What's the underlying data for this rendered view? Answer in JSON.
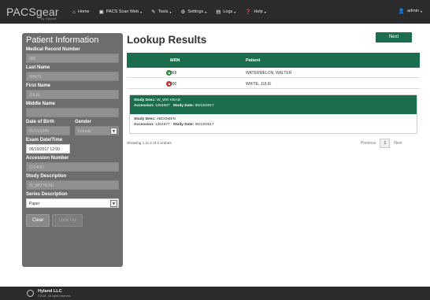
{
  "brand": {
    "name": "PACSgear",
    "sub": "by Hyland"
  },
  "nav": [
    {
      "icon": "⌂",
      "label": "Home",
      "caret": ""
    },
    {
      "icon": "▣",
      "label": "PACS Scan Web",
      "caret": "▾"
    },
    {
      "icon": "✎",
      "label": "Tools",
      "caret": "▾"
    },
    {
      "icon": "⚙",
      "label": "Settings",
      "caret": "▾"
    },
    {
      "icon": "▤",
      "label": "Logs",
      "caret": "▾"
    },
    {
      "icon": "❓",
      "label": "Help",
      "caret": "▾"
    }
  ],
  "user": {
    "icon": "👤",
    "label": "admin",
    "caret": "▾"
  },
  "form": {
    "title": "Patient Information",
    "mrn_label": "Medical Record Number",
    "mrn_value": "990",
    "last_label": "Last Name",
    "last_value": "WHITE",
    "first_label": "First Name",
    "first_value": "JULIE",
    "middle_label": "Middle Name",
    "middle_value": "",
    "dob_label": "Date of Birth",
    "dob_value": "01/01/1945",
    "gender_label": "Gender",
    "gender_value": "Female",
    "exam_label": "Exam Date/Time",
    "exam_value": "06/19/2017 12:00",
    "accession_label": "Accession Number",
    "accession_value": "1264587",
    "study_label": "Study Description",
    "study_value": "W_WO HEAD",
    "series_label": "Series Description",
    "series_value": "Paper",
    "clear_label": "Clear",
    "lookup_label": "Look Up"
  },
  "results": {
    "title": "Lookup Results",
    "next_label": "Next",
    "columns": {
      "mrn": "MRN",
      "patient": "Patient"
    },
    "rows": [
      {
        "status": "green",
        "mrn": "968",
        "patient": "WATERMELON, WALTER"
      },
      {
        "status": "red",
        "mrn": "990",
        "patient": "WHITE, JULIE"
      }
    ],
    "studies": [
      {
        "desc_label": "Study Desc:",
        "desc": "W_WO HEAD",
        "acc_label": "Accession:",
        "acc": "1264587",
        "date_label": "Study Date:",
        "date": "06/19/2017"
      },
      {
        "desc_label": "Study Desc:",
        "desc": "ABDOMEN",
        "acc_label": "Accession:",
        "acc": "1264577",
        "date_label": "Study Date:",
        "date": "06/19/2017"
      }
    ],
    "showing": "Showing 1 to 2 of 2 entries",
    "pager": {
      "prev": "Previous",
      "page": "1",
      "next": "Next"
    }
  },
  "footer": {
    "company": "Hyland LLC",
    "copyright": "©2018 - All rights reserved."
  },
  "colors": {
    "accent": "#1a6e4e",
    "topbar": "#2b2b2b",
    "panel": "#6d6d6d"
  }
}
